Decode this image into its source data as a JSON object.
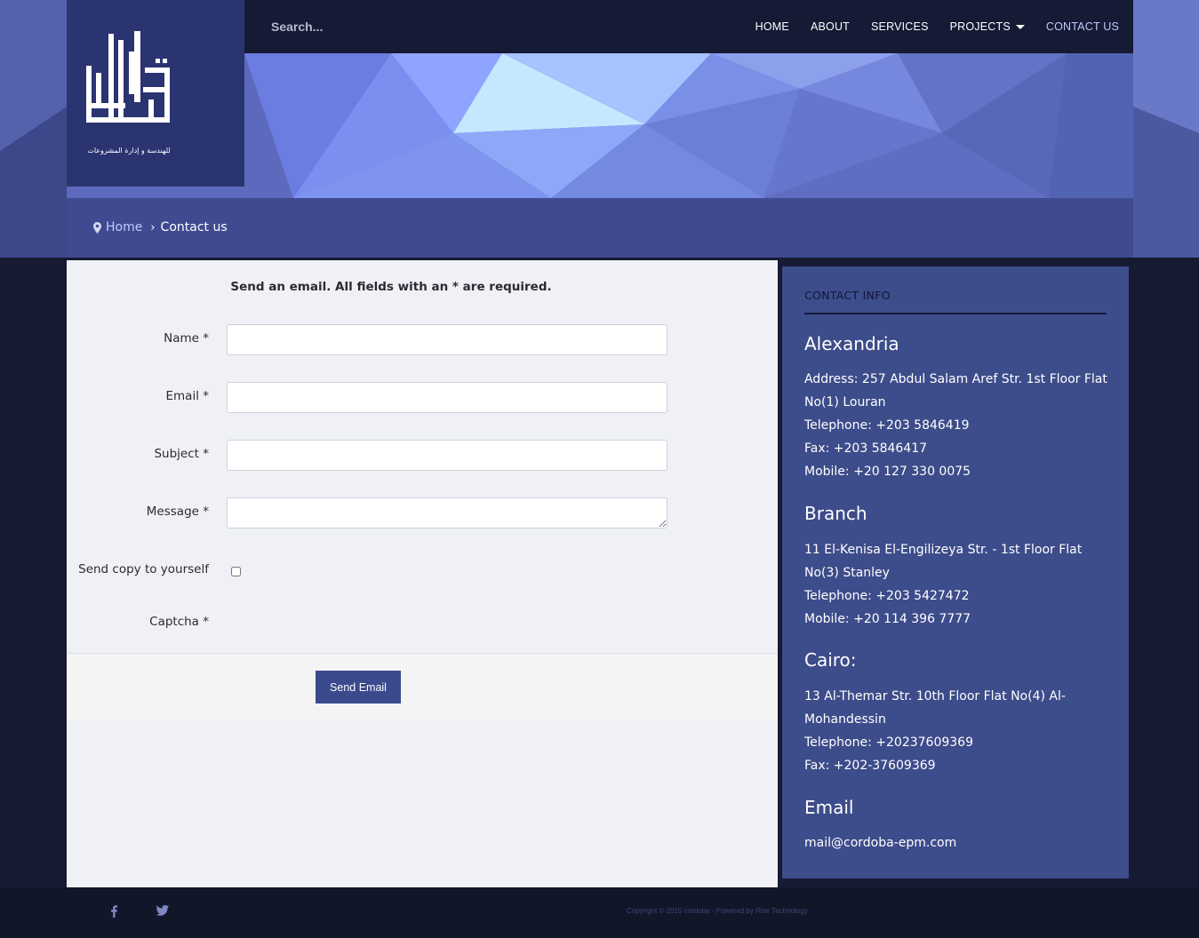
{
  "header": {
    "search_placeholder": "Search...",
    "nav": [
      {
        "label": "HOME",
        "active": false
      },
      {
        "label": "ABOUT",
        "active": false
      },
      {
        "label": "SERVICES",
        "active": false
      },
      {
        "label": "PROJECTS",
        "active": false,
        "has_dropdown": true
      },
      {
        "label": "CONTACT US",
        "active": true
      }
    ]
  },
  "logo": {
    "icon": "arabic-calligraphy-logo",
    "tagline": "للهندسة و إدارة المشروعات"
  },
  "breadcrumb": {
    "home": "Home",
    "current": "Contact us"
  },
  "form": {
    "intro": "Send an email. All fields with an * are required.",
    "fields": [
      {
        "label": "Name *",
        "value": ""
      },
      {
        "label": "Email *",
        "value": ""
      },
      {
        "label": "Subject *",
        "value": ""
      },
      {
        "label": "Message *",
        "value": ""
      }
    ],
    "copy_label": "Send copy to yourself",
    "copy_checked": false,
    "captcha_label": "Captcha *",
    "submit": "Send Email"
  },
  "contact_info": {
    "title": "CONTACT INFO",
    "sections": [
      {
        "heading": "Alexandria",
        "lines": [
          "Address: 257 Abdul Salam Aref Str. 1st Floor Flat No(1) Louran",
          "Telephone: +203 5846419",
          "Fax: +203 5846417",
          "Mobile: +20 127 330 0075"
        ]
      },
      {
        "heading": "Branch",
        "lines": [
          "11 El-Kenisa El-Engilizeya Str. - 1st Floor Flat No(3) Stanley",
          "Telephone: +203 5427472",
          "Mobile: +20 114 396 7777"
        ]
      },
      {
        "heading": "Cairo:",
        "lines": [
          "13 Al-Themar Str. 10th Floor Flat No(4) Al-Mohandessin",
          "Telephone: +20237609369",
          "Fax: +202-37609369"
        ]
      },
      {
        "heading": "Email",
        "lines": [
          "mail@cordoba-epm.com"
        ]
      }
    ]
  },
  "footer": {
    "copyright": "Copyright © 2015 cordoba - Powered by Rise Technology",
    "social": [
      "facebook-icon",
      "twitter-icon"
    ]
  },
  "colors": {
    "page_background": "#161a32",
    "topbar": "#151a35",
    "logo_box": "#2a3470",
    "sidebar": "#3d4c8a",
    "button": "#3a4a8c",
    "active_nav": "#c3c9ff"
  }
}
